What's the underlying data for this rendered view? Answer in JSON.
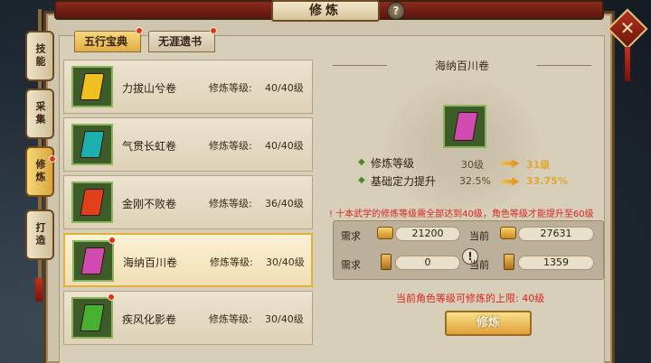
{
  "window": {
    "title": "修炼",
    "help_glyph": "?",
    "close_glyph": "✕"
  },
  "side_tabs": [
    {
      "label": "技能",
      "active": false
    },
    {
      "label": "采集",
      "active": false
    },
    {
      "label": "修炼",
      "active": true
    },
    {
      "label": "打造",
      "active": false
    }
  ],
  "tabs": [
    {
      "label": "五行宝典",
      "active": true
    },
    {
      "label": "无涯遗书",
      "active": false
    }
  ],
  "scrolls": [
    {
      "name": "力拔山兮卷",
      "level_label": "修炼等级:",
      "level": "40/40级",
      "color": "#f0c020",
      "selected": false,
      "red_dot": false
    },
    {
      "name": "气贯长虹卷",
      "level_label": "修炼等级:",
      "level": "40/40级",
      "color": "#1eb0b0",
      "selected": false,
      "red_dot": false
    },
    {
      "name": "金刚不败卷",
      "level_label": "修炼等级:",
      "level": "36/40级",
      "color": "#e2401c",
      "selected": false,
      "red_dot": false
    },
    {
      "name": "海纳百川卷",
      "level_label": "修炼等级:",
      "level": "30/40级",
      "color": "#d04ab0",
      "selected": true,
      "red_dot": true
    },
    {
      "name": "疾风化影卷",
      "level_label": "修炼等级:",
      "level": "30/40级",
      "color": "#48b030",
      "selected": false,
      "red_dot": true
    }
  ],
  "detail": {
    "title": "海纳百川卷",
    "book_color": "#d04ab0",
    "stats": [
      {
        "label": "修炼等级",
        "current": "30级",
        "next": "31级"
      },
      {
        "label": "基础定力提升",
        "current": "32.5%",
        "next": "33.75%"
      }
    ],
    "warning": "! 十本武学的修炼等级需全部达到40级，角色等级才能提升至60级",
    "requirements": [
      {
        "need_label": "需求",
        "need": "21200",
        "have_label": "当前",
        "have": "27631",
        "icon": "coin-icon"
      },
      {
        "need_label": "需求",
        "need": "0",
        "have_label": "当前",
        "have": "1359",
        "icon": "scroll-icon"
      }
    ],
    "exclaim_glyph": "!",
    "max_note": "当前角色等级可修炼的上限: 40级",
    "action_label": "修炼"
  }
}
